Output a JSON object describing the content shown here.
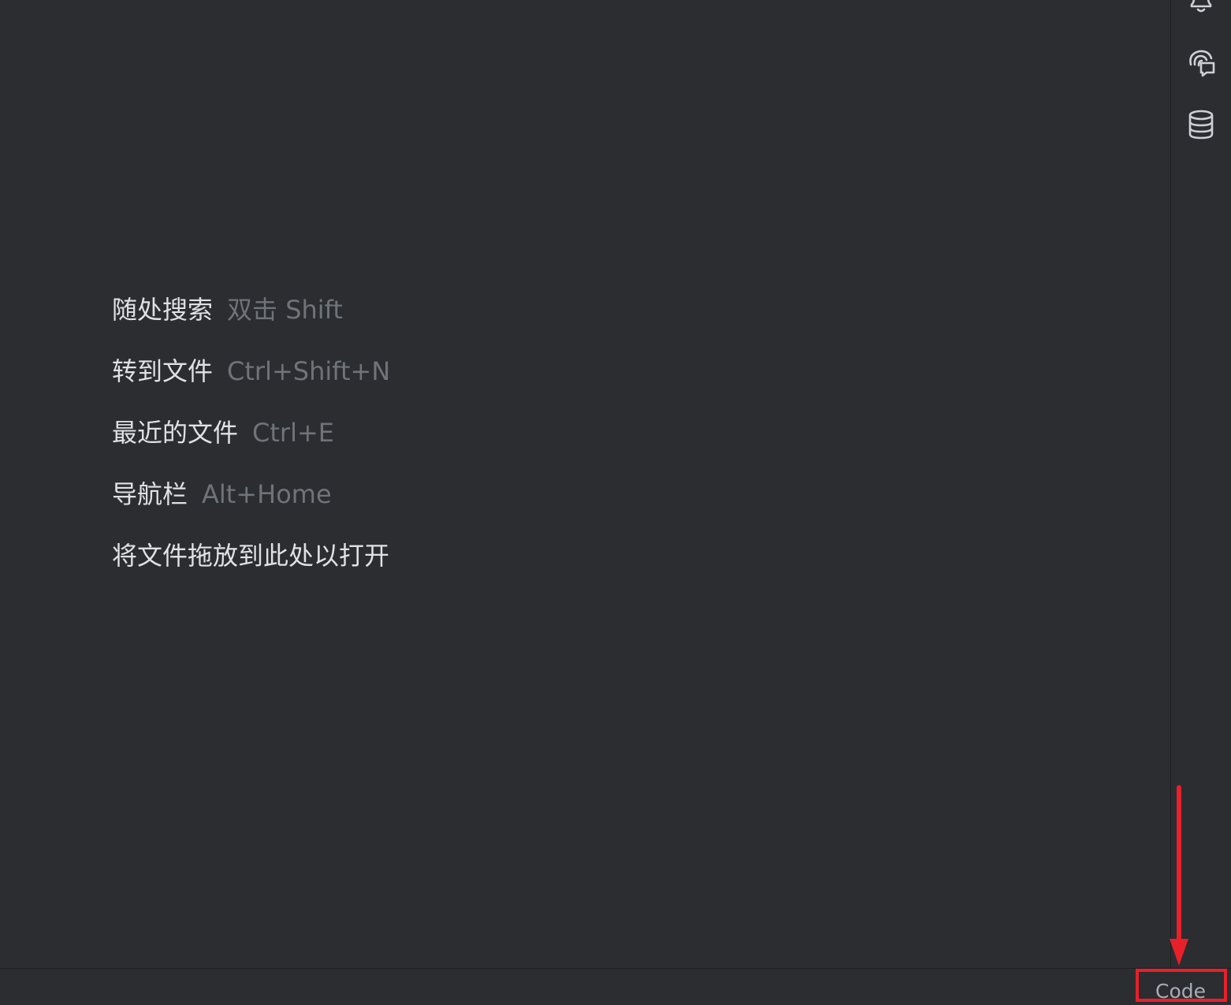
{
  "editor": {
    "hints": [
      {
        "action": "随处搜索",
        "shortcut": "双击 Shift"
      },
      {
        "action": "转到文件",
        "shortcut": "Ctrl+Shift+N"
      },
      {
        "action": "最近的文件",
        "shortcut": "Ctrl+E"
      },
      {
        "action": "导航栏",
        "shortcut": "Alt+Home"
      },
      {
        "action": "将文件拖放到此处以打开",
        "shortcut": ""
      }
    ]
  },
  "right_stripe": {
    "buttons": [
      {
        "icon": "bell-icon"
      },
      {
        "icon": "ai-assistant-chat-icon"
      },
      {
        "icon": "database-icon"
      }
    ]
  },
  "status_bar": {
    "widget_label": "Code"
  },
  "colors": {
    "background": "#2b2d30",
    "hint_action": "#dfe1e5",
    "hint_shortcut": "#6f737a",
    "icon": "#ced0d6",
    "annotation": "#e8202a"
  }
}
